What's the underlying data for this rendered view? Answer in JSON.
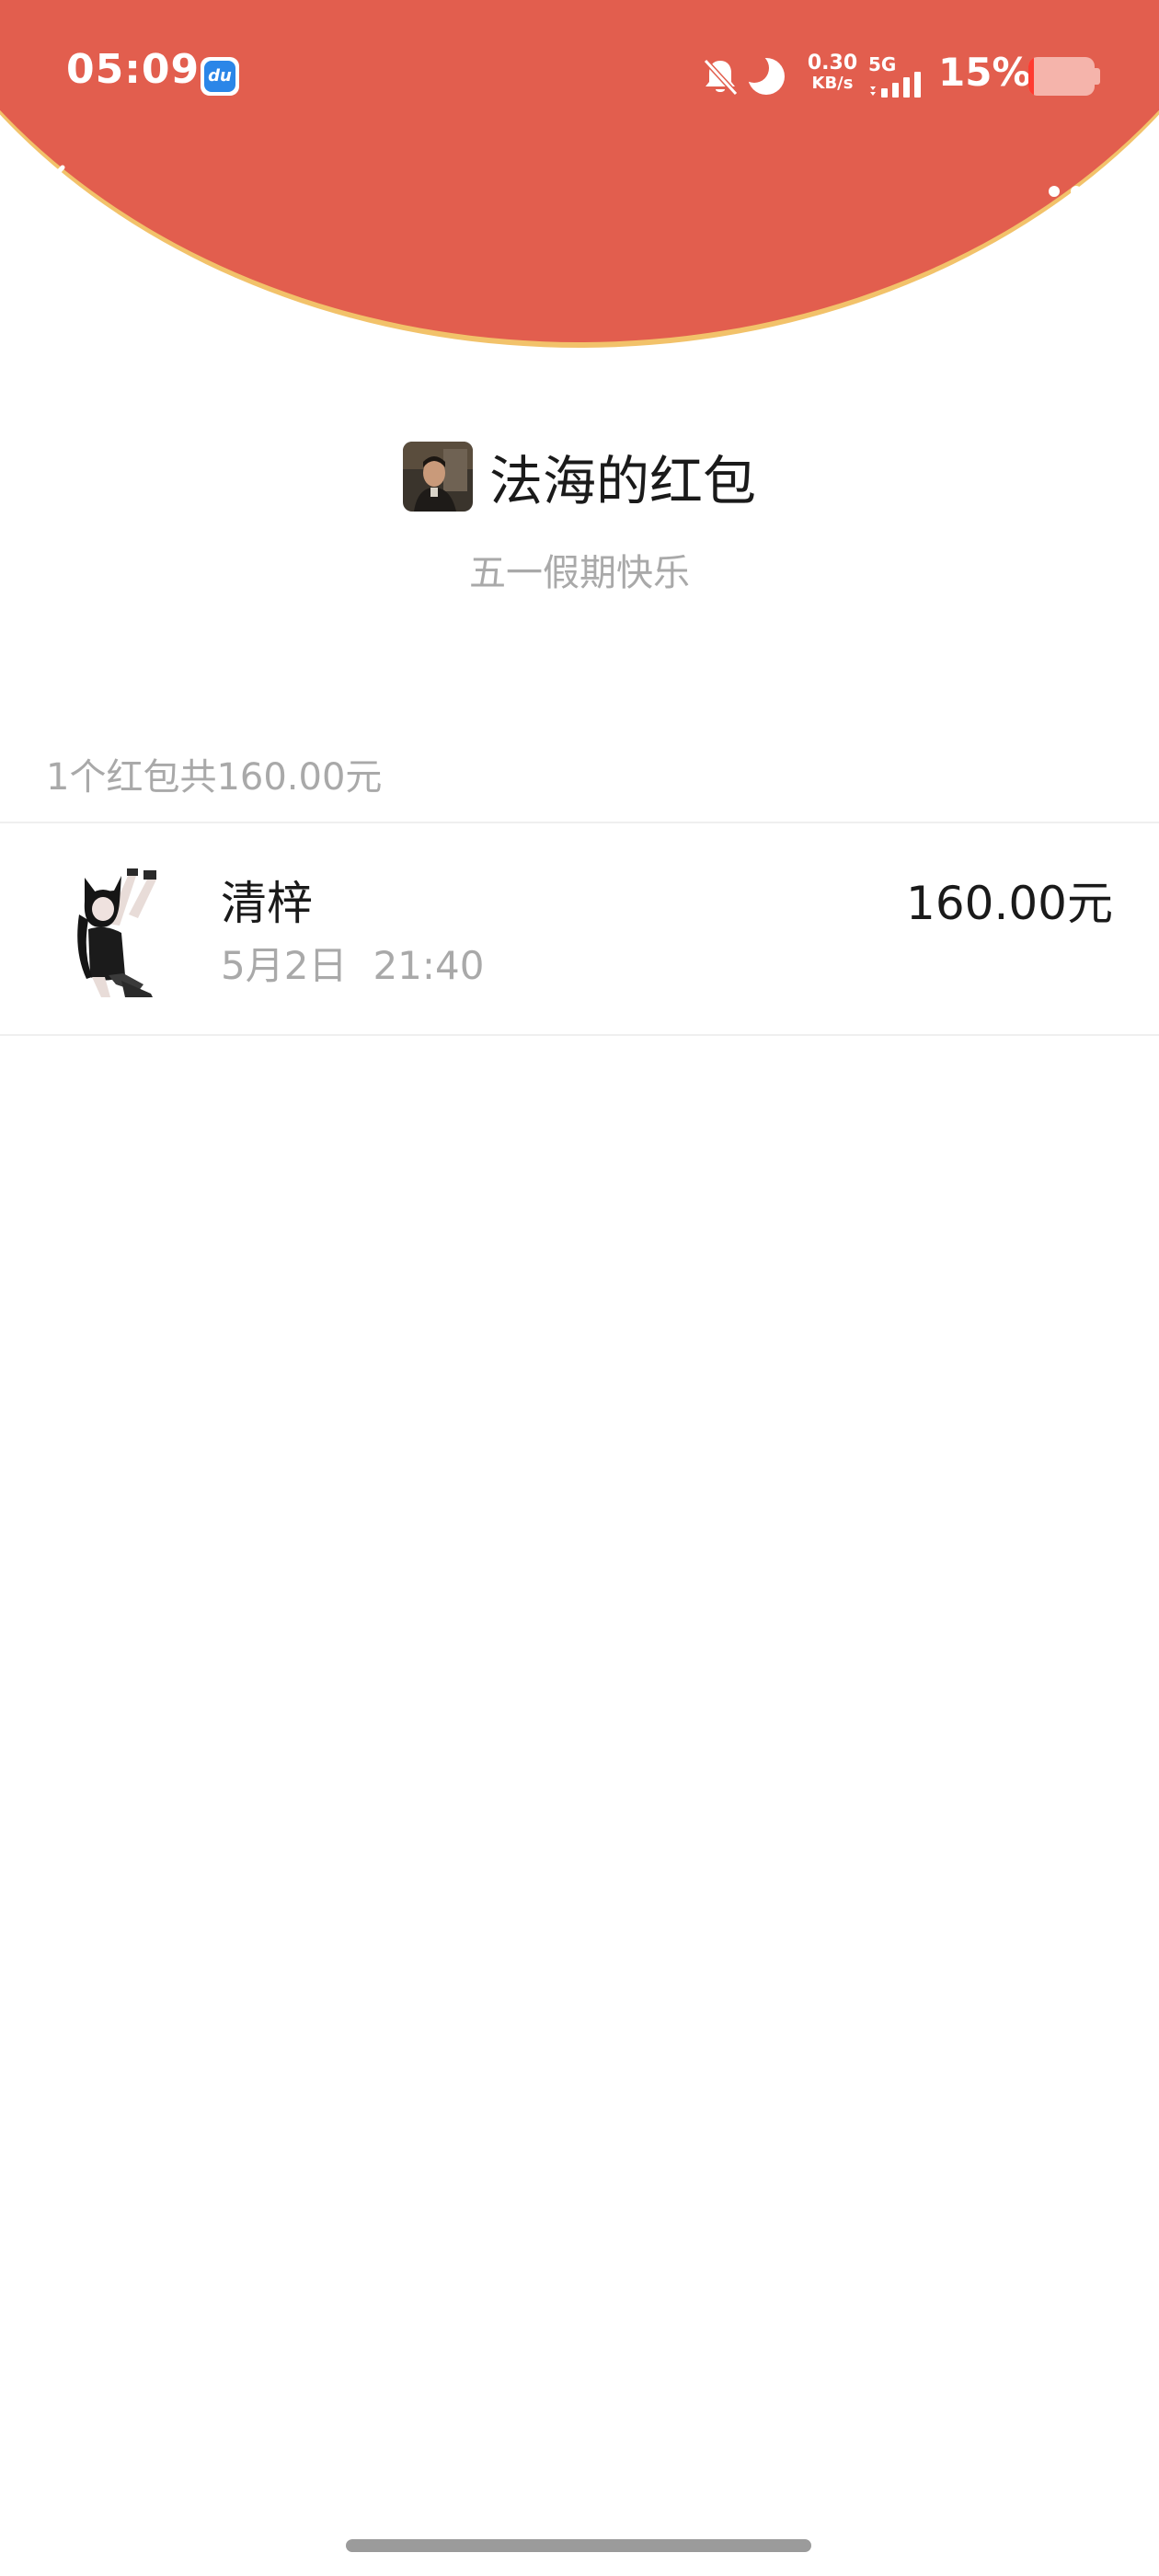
{
  "status_bar": {
    "time": "05:09",
    "app_badge_text": "du",
    "net_speed_value": "0.30",
    "net_speed_unit": "KB/s",
    "network_type": "5G",
    "battery_percent": "15%",
    "battery_level": 0.15,
    "icons": [
      "baidu-app-icon",
      "bell-muted-icon",
      "moon-icon",
      "signal-icon",
      "battery-icon"
    ]
  },
  "nav": {
    "back_icon": "chevron-left-icon",
    "more_icon": "more-dots-icon"
  },
  "colors": {
    "header_red": "#e25e4e",
    "header_rim": "#f2c26a",
    "primary_text": "#1a1a1a",
    "secondary_text": "#a9a9a9"
  },
  "envelope": {
    "sender_title": "法海的红包",
    "wishing": "五一假期快乐",
    "summary": "1个红包共160.00元"
  },
  "records": [
    {
      "name": "清梓",
      "date": "5月2日",
      "time": "21:40",
      "amount": "160.00元"
    }
  ]
}
